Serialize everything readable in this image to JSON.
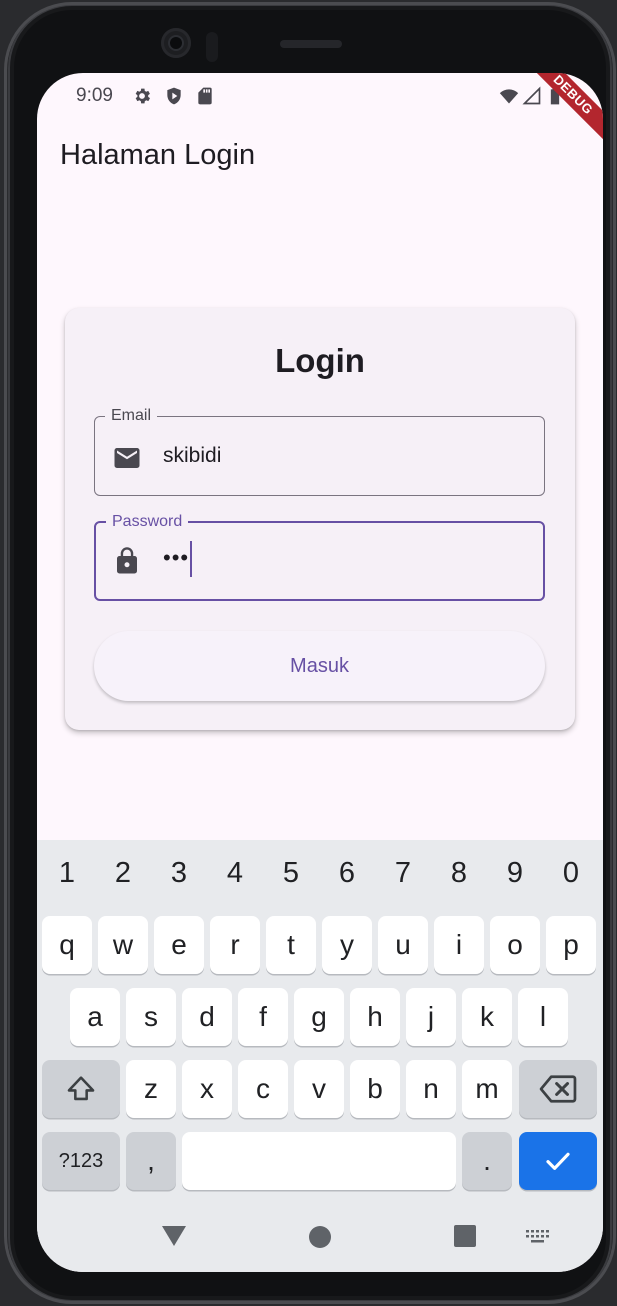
{
  "status_bar": {
    "time": "9:09",
    "left_icons": [
      "gear-icon",
      "shield-play-icon",
      "sd-card-icon"
    ],
    "right_icons": [
      "wifi-icon",
      "signal-icon",
      "battery-icon"
    ]
  },
  "debug_banner": "DEBUG",
  "app_bar": {
    "title": "Halaman Login"
  },
  "card": {
    "title": "Login",
    "email": {
      "label": "Email",
      "value": "skibidi",
      "icon": "mail-icon"
    },
    "password": {
      "label": "Password",
      "value": "•••",
      "icon": "lock-icon"
    },
    "submit_label": "Masuk"
  },
  "keyboard": {
    "numbers": [
      "1",
      "2",
      "3",
      "4",
      "5",
      "6",
      "7",
      "8",
      "9",
      "0"
    ],
    "row1": [
      "q",
      "w",
      "e",
      "r",
      "t",
      "y",
      "u",
      "i",
      "o",
      "p"
    ],
    "row2": [
      "a",
      "s",
      "d",
      "f",
      "g",
      "h",
      "j",
      "k",
      "l"
    ],
    "row3": [
      "z",
      "x",
      "c",
      "v",
      "b",
      "n",
      "m"
    ],
    "symbols_label": "?123",
    "comma": ",",
    "period": "."
  },
  "nav_bar": {
    "items": [
      "back-triangle-icon",
      "home-circle-icon",
      "recents-square-icon",
      "keyboard-switch-icon"
    ]
  },
  "colors": {
    "primary": "#6750a4",
    "background": "#fef7fd",
    "card": "#f6f0f7",
    "keyboard_bg": "#e8eaed",
    "enter_key": "#1a73e8",
    "debug_ribbon": "#b3262e"
  }
}
